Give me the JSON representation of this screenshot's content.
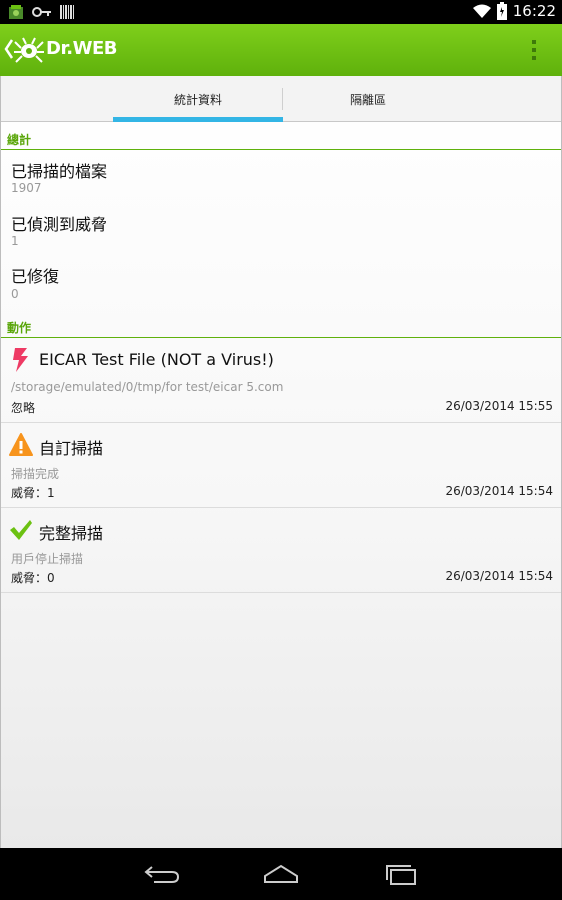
{
  "status_bar": {
    "time": "16:22",
    "icons": [
      "drweb-notification-icon",
      "key-icon",
      "barcode-icon",
      "wifi-icon",
      "battery-icon"
    ]
  },
  "action_bar": {
    "title": "Dr.WEB",
    "color": "#6cc112"
  },
  "tabs": [
    {
      "label": "統計資料",
      "selected": true
    },
    {
      "label": "隔離區",
      "selected": false
    }
  ],
  "stats": {
    "header": "總計",
    "items": [
      {
        "label": "已掃描的檔案",
        "value": "1907"
      },
      {
        "label": "已偵測到威脅",
        "value": "1"
      },
      {
        "label": "已修復",
        "value": "0"
      }
    ]
  },
  "actions": {
    "header": "動作",
    "items": [
      {
        "icon": "lightning-icon",
        "title": "EICAR Test File (NOT a Virus!)",
        "subtitle": "/storage/emulated/0/tmp/for test/eicar 5.com",
        "status": "忽略",
        "date": "26/03/2014 15:55"
      },
      {
        "icon": "warning-icon",
        "title": "自訂掃描",
        "subtitle": "掃描完成",
        "status": "威脅：1",
        "date": "26/03/2014 15:54"
      },
      {
        "icon": "checkmark-icon",
        "title": "完整掃描",
        "subtitle": "用戶停止掃描",
        "status": "威脅：0",
        "date": "26/03/2014 15:54"
      }
    ]
  },
  "nav_bar": {
    "buttons": [
      "back-icon",
      "home-icon",
      "recent-apps-icon"
    ]
  }
}
